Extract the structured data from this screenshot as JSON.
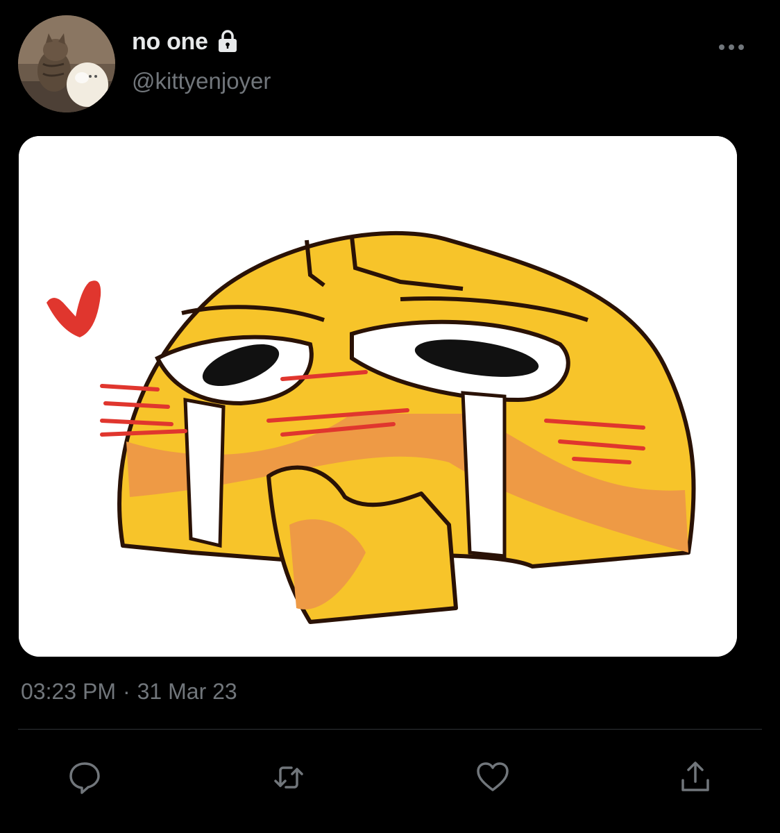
{
  "author": {
    "display_name": "no one",
    "handle": "@kittyenjoyer",
    "protected_icon": "lock-icon",
    "avatar_icon": "cat-avatar"
  },
  "header": {
    "more_icon": "more-horizontal-icon"
  },
  "media": {
    "icon": "crying-blushing-emoji-image"
  },
  "meta": {
    "time": "03:23 PM",
    "separator": "·",
    "date": "31 Mar 23"
  },
  "actions": [
    {
      "name": "reply",
      "icon": "reply-icon"
    },
    {
      "name": "retweet",
      "icon": "retweet-icon"
    },
    {
      "name": "like",
      "icon": "heart-icon"
    },
    {
      "name": "share",
      "icon": "share-icon"
    }
  ],
  "colors": {
    "background": "#000000",
    "primary_text": "#e7e9ea",
    "secondary_text": "#71767b",
    "divider": "#2f3336",
    "emoji_yellow": "#f7c42a",
    "emoji_orange": "#ee9a45",
    "emoji_red": "#e0362e"
  }
}
